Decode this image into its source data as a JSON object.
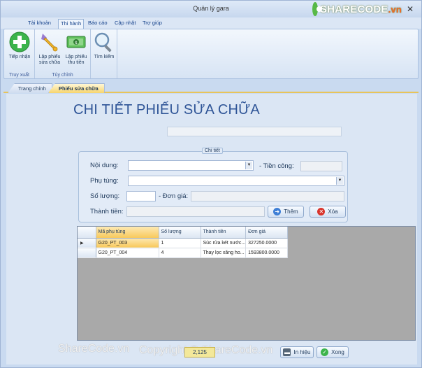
{
  "window": {
    "title": "Quản lý gara",
    "close_glyph": "✕"
  },
  "logo": {
    "main": "SHARECODE",
    "domain": ".vn"
  },
  "menu": {
    "tabs": [
      {
        "label": "Tài khoản"
      },
      {
        "label": "Thi hành"
      },
      {
        "label": "Báo cáo"
      },
      {
        "label": "Cập nhật"
      },
      {
        "label": "Trợ giúp"
      }
    ],
    "active": "Thi hành"
  },
  "ribbon": {
    "groups": [
      {
        "label": "Truy xuất"
      },
      {
        "label": "Tùy chỉnh"
      }
    ],
    "buttons": [
      {
        "label_1": "Tiếp nhận",
        "label_2": "",
        "icon": "add-icon"
      },
      {
        "label_1": "Lập phiếu",
        "label_2": "sửa chữa",
        "icon": "wrench-icon"
      },
      {
        "label_1": "Lập phiếu",
        "label_2": "thu tiền",
        "icon": "money-icon"
      },
      {
        "label_1": "Tìm kiếm",
        "label_2": "",
        "icon": "magnifier-icon"
      }
    ]
  },
  "doc_tabs": [
    {
      "label": "Trang chính"
    },
    {
      "label": "Phiếu sửa chữa"
    }
  ],
  "page": {
    "heading": "CHI TIẾT PHIẾU SỬA CHỮA"
  },
  "form": {
    "group_title": "Chi tiết",
    "noi_dung_label": "Nội dung:",
    "tien_cong_label": "- Tiền công:",
    "phu_tung_label": "Phụ tùng:",
    "so_luong_label": "Số lượng:",
    "don_gia_label": "- Đơn giá:",
    "thanh_tien_label": "Thành tiền:",
    "add_button": "Thêm",
    "delete_button": "Xóa",
    "noi_dung_value": "",
    "tien_cong_value": "",
    "phu_tung_value": "",
    "so_luong_value": "",
    "don_gia_value": "",
    "thanh_tien_value": ""
  },
  "grid": {
    "columns": [
      "Mã phụ tùng",
      "Số lượng",
      "Thành tiền",
      "Đơn giá"
    ],
    "rows": [
      {
        "ma": "G20_PT_003",
        "sl": "1",
        "tt": "Súc rửa két nước...",
        "dg": "327250.0000"
      },
      {
        "ma": "G20_PT_004",
        "sl": "4",
        "tt": "Thay lọc xăng ho...",
        "dg": "1593800.0000"
      }
    ],
    "current_row_marker": "▶"
  },
  "footer": {
    "counter": "2,125",
    "print_button": "In hiệu",
    "done_button": "Xong",
    "watermark_1": "ShareCode.vn",
    "watermark_2": "Copyright © ShareCode.vn"
  },
  "colors": {
    "heading": "#2f5597",
    "accent_tab": "#f7d46d",
    "add_icon": "#3cb44b",
    "delete_icon": "#d9342b"
  }
}
